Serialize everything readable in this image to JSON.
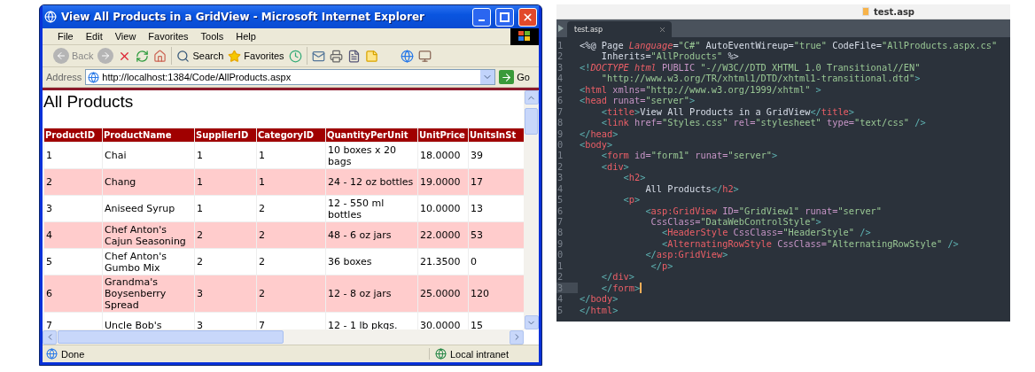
{
  "browser": {
    "title": "View All Products in a GridView - Microsoft Internet Explorer",
    "menu": [
      "File",
      "Edit",
      "View",
      "Favorites",
      "Tools",
      "Help"
    ],
    "toolbar": {
      "back": "Back",
      "search": "Search",
      "favorites": "Favorites"
    },
    "address": {
      "label": "Address",
      "value": "http://localhost:1384/Code/AllProducts.aspx",
      "go": "Go"
    },
    "page": {
      "heading": "All Products",
      "table": {
        "columns": [
          "ProductID",
          "ProductName",
          "SupplierID",
          "CategoryID",
          "QuantityPerUnit",
          "UnitPrice",
          "UnitsInSt"
        ],
        "rows": [
          [
            "1",
            "Chai",
            "1",
            "1",
            "10 boxes x 20 bags",
            "18.0000",
            "39"
          ],
          [
            "2",
            "Chang",
            "1",
            "1",
            "24 - 12 oz bottles",
            "19.0000",
            "17"
          ],
          [
            "3",
            "Aniseed Syrup",
            "1",
            "2",
            "12 - 550 ml bottles",
            "10.0000",
            "13"
          ],
          [
            "4",
            "Chef Anton's Cajun Seasoning",
            "2",
            "2",
            "48 - 6 oz jars",
            "22.0000",
            "53"
          ],
          [
            "5",
            "Chef Anton's Gumbo Mix",
            "2",
            "2",
            "36 boxes",
            "21.3500",
            "0"
          ],
          [
            "6",
            "Grandma's Boysenberry Spread",
            "3",
            "2",
            "12 - 8 oz jars",
            "25.0000",
            "120"
          ],
          [
            "7",
            "Uncle Bob's",
            "3",
            "7",
            "12 - 1 lb pkgs.",
            "30.0000",
            "15"
          ]
        ]
      }
    },
    "status_bar": {
      "text": "Done",
      "zone": "Local intranet"
    }
  },
  "editor": {
    "window_title": "test.asp",
    "tabs": [
      {
        "label": "test.asp",
        "selected": true
      }
    ],
    "lines": [
      {
        "number": "1",
        "current": false,
        "tokens": [
          {
            "kind": "x",
            "text": "<%@ Page "
          },
          {
            "kind": "k",
            "text": "Language"
          },
          {
            "kind": "x",
            "text": "="
          },
          {
            "kind": "s",
            "text": "\"C#\""
          },
          {
            "kind": "x",
            "text": " AutoEventWireup="
          },
          {
            "kind": "s",
            "text": "\"true\""
          },
          {
            "kind": "x",
            "text": " CodeFile="
          },
          {
            "kind": "s",
            "text": "\"AllProducts.aspx.cs\""
          }
        ]
      },
      {
        "number": "2",
        "current": false,
        "tokens": [
          {
            "kind": "x",
            "text": "    Inherits="
          },
          {
            "kind": "s",
            "text": "\"AllProducts\""
          },
          {
            "kind": "x",
            "text": " %>"
          }
        ]
      },
      {
        "number": "3",
        "current": false,
        "tokens": [
          {
            "kind": "p",
            "text": "<!"
          },
          {
            "kind": "k",
            "text": "DOCTYPE html"
          },
          {
            "kind": "a",
            "text": " PUBLIC "
          },
          {
            "kind": "s",
            "text": "\"-//W3C//DTD XHTML 1.0 Transitional//EN\""
          }
        ]
      },
      {
        "number": "4",
        "current": false,
        "tokens": [
          {
            "kind": "s",
            "text": "    \"http://www.w3.org/TR/xhtml1/DTD/xhtml1-transitional.dtd\""
          },
          {
            "kind": "p",
            "text": ">"
          }
        ]
      },
      {
        "number": "5",
        "current": false,
        "tokens": [
          {
            "kind": "p",
            "text": "<"
          },
          {
            "kind": "t",
            "text": "html"
          },
          {
            "kind": "a",
            "text": " xmlns="
          },
          {
            "kind": "s",
            "text": "\"http://www.w3.org/1999/xhtml\""
          },
          {
            "kind": "p",
            "text": " >"
          }
        ]
      },
      {
        "number": "6",
        "current": false,
        "tokens": [
          {
            "kind": "p",
            "text": "<"
          },
          {
            "kind": "t",
            "text": "head"
          },
          {
            "kind": "a",
            "text": " runat="
          },
          {
            "kind": "s",
            "text": "\"server\""
          },
          {
            "kind": "p",
            "text": ">"
          }
        ]
      },
      {
        "number": "7",
        "current": false,
        "tokens": [
          {
            "kind": "p",
            "text": "    <"
          },
          {
            "kind": "t",
            "text": "title"
          },
          {
            "kind": "p",
            "text": ">"
          },
          {
            "kind": "x",
            "text": "View All Products in a GridView"
          },
          {
            "kind": "p",
            "text": "</"
          },
          {
            "kind": "t",
            "text": "title"
          },
          {
            "kind": "p",
            "text": ">"
          }
        ]
      },
      {
        "number": "8",
        "current": false,
        "tokens": [
          {
            "kind": "p",
            "text": "    <"
          },
          {
            "kind": "t",
            "text": "link"
          },
          {
            "kind": "a",
            "text": " href="
          },
          {
            "kind": "s",
            "text": "\"Styles.css\""
          },
          {
            "kind": "a",
            "text": " rel="
          },
          {
            "kind": "s",
            "text": "\"stylesheet\""
          },
          {
            "kind": "a",
            "text": " type="
          },
          {
            "kind": "s",
            "text": "\"text/css\""
          },
          {
            "kind": "p",
            "text": " />"
          }
        ]
      },
      {
        "number": "9",
        "current": false,
        "tokens": [
          {
            "kind": "p",
            "text": "</"
          },
          {
            "kind": "t",
            "text": "head"
          },
          {
            "kind": "p",
            "text": ">"
          }
        ]
      },
      {
        "number": "0",
        "current": false,
        "tokens": [
          {
            "kind": "p",
            "text": "<"
          },
          {
            "kind": "t",
            "text": "body"
          },
          {
            "kind": "p",
            "text": ">"
          }
        ]
      },
      {
        "number": "1",
        "current": false,
        "tokens": [
          {
            "kind": "p",
            "text": "    <"
          },
          {
            "kind": "t",
            "text": "form"
          },
          {
            "kind": "a",
            "text": " id="
          },
          {
            "kind": "s",
            "text": "\"form1\""
          },
          {
            "kind": "a",
            "text": " runat="
          },
          {
            "kind": "s",
            "text": "\"server\""
          },
          {
            "kind": "p",
            "text": ">"
          }
        ]
      },
      {
        "number": "2",
        "current": false,
        "tokens": [
          {
            "kind": "p",
            "text": "    <"
          },
          {
            "kind": "t",
            "text": "div"
          },
          {
            "kind": "p",
            "text": ">"
          }
        ]
      },
      {
        "number": "3",
        "current": false,
        "tokens": [
          {
            "kind": "p",
            "text": "        <"
          },
          {
            "kind": "t",
            "text": "h2"
          },
          {
            "kind": "p",
            "text": ">"
          }
        ]
      },
      {
        "number": "4",
        "current": false,
        "tokens": [
          {
            "kind": "x",
            "text": "            All Products"
          },
          {
            "kind": "p",
            "text": "</"
          },
          {
            "kind": "t",
            "text": "h2"
          },
          {
            "kind": "p",
            "text": ">"
          }
        ]
      },
      {
        "number": "5",
        "current": false,
        "tokens": [
          {
            "kind": "p",
            "text": "        <"
          },
          {
            "kind": "t",
            "text": "p"
          },
          {
            "kind": "p",
            "text": ">"
          }
        ]
      },
      {
        "number": "6",
        "current": false,
        "tokens": [
          {
            "kind": "p",
            "text": "            <"
          },
          {
            "kind": "t",
            "text": "asp:GridView"
          },
          {
            "kind": "a",
            "text": " ID="
          },
          {
            "kind": "s",
            "text": "\"GridView1\""
          },
          {
            "kind": "a",
            "text": " runat="
          },
          {
            "kind": "s",
            "text": "\"server\""
          }
        ]
      },
      {
        "number": "7",
        "current": false,
        "tokens": [
          {
            "kind": "a",
            "text": "             CssClass="
          },
          {
            "kind": "s",
            "text": "\"DataWebControlStyle\""
          },
          {
            "kind": "p",
            "text": ">"
          }
        ]
      },
      {
        "number": "8",
        "current": false,
        "tokens": [
          {
            "kind": "p",
            "text": "               <"
          },
          {
            "kind": "t",
            "text": "HeaderStyle"
          },
          {
            "kind": "a",
            "text": " CssClass="
          },
          {
            "kind": "s",
            "text": "\"HeaderStyle\""
          },
          {
            "kind": "p",
            "text": " />"
          }
        ]
      },
      {
        "number": "9",
        "current": false,
        "tokens": [
          {
            "kind": "p",
            "text": "               <"
          },
          {
            "kind": "t",
            "text": "AlternatingRowStyle"
          },
          {
            "kind": "a",
            "text": " CssClass="
          },
          {
            "kind": "s",
            "text": "\"AlternatingRowStyle\""
          },
          {
            "kind": "p",
            "text": " />"
          }
        ]
      },
      {
        "number": "0",
        "current": false,
        "tokens": [
          {
            "kind": "p",
            "text": "            </"
          },
          {
            "kind": "t",
            "text": "asp:GridView"
          },
          {
            "kind": "p",
            "text": ">"
          }
        ]
      },
      {
        "number": "1",
        "current": false,
        "tokens": [
          {
            "kind": "p",
            "text": "             </"
          },
          {
            "kind": "t",
            "text": "p"
          },
          {
            "kind": "p",
            "text": ">"
          }
        ]
      },
      {
        "number": "2",
        "current": false,
        "tokens": [
          {
            "kind": "p",
            "text": "    </"
          },
          {
            "kind": "t",
            "text": "div"
          },
          {
            "kind": "p",
            "text": ">"
          }
        ]
      },
      {
        "number": "3",
        "current": true,
        "tokens": [
          {
            "kind": "p",
            "text": "    </"
          },
          {
            "kind": "t",
            "text": "form"
          },
          {
            "kind": "p",
            "text": ">"
          }
        ]
      },
      {
        "number": "4",
        "current": false,
        "tokens": [
          {
            "kind": "p",
            "text": "</"
          },
          {
            "kind": "t",
            "text": "body"
          },
          {
            "kind": "p",
            "text": ">"
          }
        ]
      },
      {
        "number": "5",
        "current": false,
        "tokens": [
          {
            "kind": "p",
            "text": "</"
          },
          {
            "kind": "t",
            "text": "html"
          },
          {
            "kind": "p",
            "text": ">"
          }
        ]
      }
    ]
  }
}
